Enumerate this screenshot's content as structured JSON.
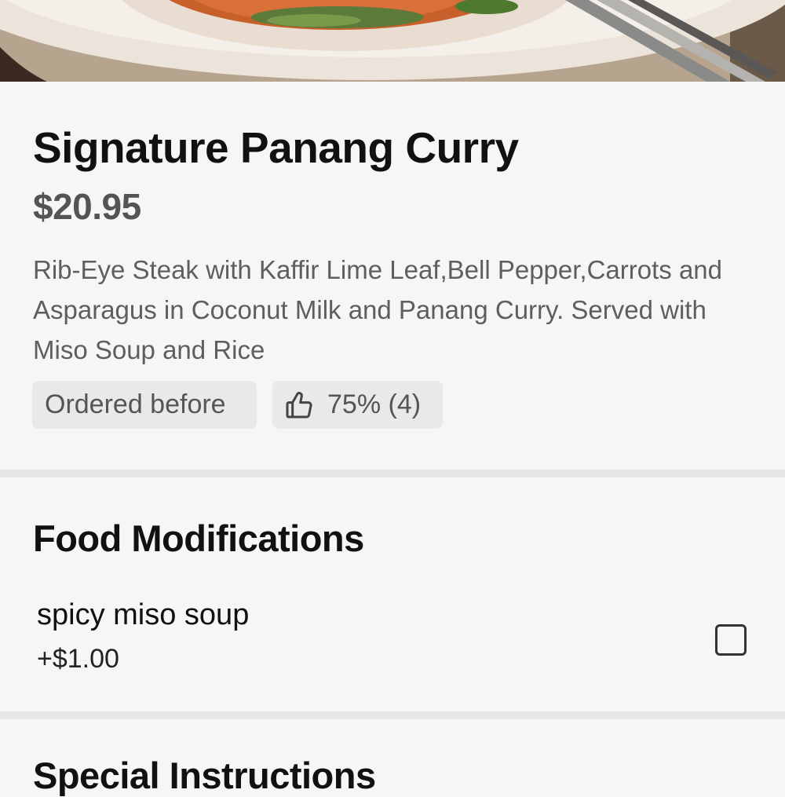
{
  "item": {
    "title": "Signature Panang Curry",
    "price": "$20.95",
    "description": "Rib-Eye Steak with Kaffir Lime Leaf,Bell Pepper,Carrots and Asparagus in Coconut Milk and Panang Curry. Served with Miso Soup and Rice",
    "ordered_before_label": "Ordered before",
    "rating_label": "75% (4)",
    "rating_icon": "thumbs-up-icon"
  },
  "modifications": {
    "heading": "Food Modifications",
    "options": [
      {
        "label": "spicy miso soup",
        "price": "+$1.00",
        "checked": false
      }
    ]
  },
  "special_instructions": {
    "heading": "Special Instructions"
  },
  "colors": {
    "background": "#f6f6f6",
    "divider": "#e7e7e7",
    "chip": "#e9e9e9",
    "text_primary": "#111111",
    "text_secondary": "#5e5e5e"
  }
}
